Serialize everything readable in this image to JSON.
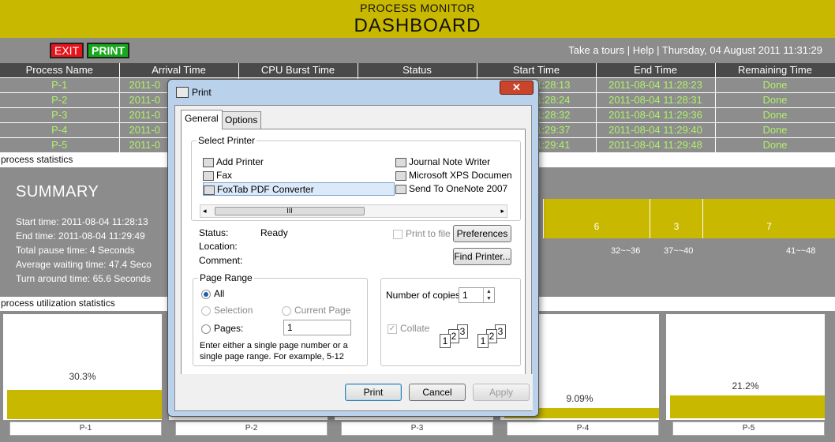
{
  "header": {
    "subtitle": "PROCESS MONITOR",
    "title": "DASHBOARD"
  },
  "toolbar": {
    "exit_label": "EXIT",
    "print_label": "PRINT",
    "tours_link": "Take a tours",
    "sep1": "|",
    "help_link": "Help",
    "sep2": "|",
    "datetime": "Thursday, 04 August 2011 11:31:29"
  },
  "table": {
    "columns": [
      "Process Name",
      "Arrival Time",
      "CPU Burst Time",
      "Status",
      "Start Time",
      "End Time",
      "Remaining Time"
    ],
    "rows": [
      {
        "name": "P-1",
        "arrival": "2011-0",
        "burst": "",
        "status": "",
        "start": "11:28:13",
        "end": "2011-08-04 11:28:23",
        "remaining": "Done"
      },
      {
        "name": "P-2",
        "arrival": "2011-0",
        "burst": "",
        "status": "",
        "start": "11:28:24",
        "end": "2011-08-04 11:28:31",
        "remaining": "Done"
      },
      {
        "name": "P-3",
        "arrival": "2011-0",
        "burst": "",
        "status": "",
        "start": "11:28:32",
        "end": "2011-08-04 11:29:36",
        "remaining": "Done"
      },
      {
        "name": "P-4",
        "arrival": "2011-0",
        "burst": "",
        "status": "",
        "start": "11:29:37",
        "end": "2011-08-04 11:29:40",
        "remaining": "Done"
      },
      {
        "name": "P-5",
        "arrival": "2011-0",
        "burst": "",
        "status": "",
        "start": "11:29:41",
        "end": "2011-08-04 11:29:48",
        "remaining": "Done"
      }
    ]
  },
  "stats_section": {
    "label": "process statistics"
  },
  "summary": {
    "title": "SUMMARY",
    "start_time": "Start time: 2011-08-04 11:28:13",
    "end_time": "End time: 2011-08-04 11:29:49",
    "pause_time": "Total pause time: 4 Seconds",
    "avg_waiting": "Average waiting time: 47.4 Seco",
    "turnaround": "Turn around time: 65.6 Seconds",
    "gantt": [
      {
        "value": "6",
        "range": "32~~36"
      },
      {
        "value": "3",
        "range": "37~~40"
      },
      {
        "value": "7",
        "range": "41~~48"
      }
    ]
  },
  "util_section": {
    "label": "process utilization statistics"
  },
  "utilization": [
    {
      "process": "P-1",
      "percent_text": "30.3%",
      "percent": 30.3
    },
    {
      "process": "P-2",
      "percent_text": "",
      "percent": 0
    },
    {
      "process": "P-3",
      "percent_text": "",
      "percent": 0
    },
    {
      "process": "P-4",
      "percent_text": "9.09%",
      "percent": 9.09
    },
    {
      "process": "P-5",
      "percent_text": "21.2%",
      "percent": 21.2
    }
  ],
  "dialog": {
    "title": "Print",
    "close_label": "✕",
    "tabs": {
      "general": "General",
      "options": "Options"
    },
    "select_printer": {
      "title": "Select Printer",
      "printers": [
        "Add Printer",
        "Fax",
        "FoxTab PDF Converter",
        "Journal Note Writer",
        "Microsoft XPS Documen",
        "Send To OneNote 2007"
      ],
      "selected": "FoxTab PDF Converter",
      "scroll_left": "◂",
      "scroll_right": "▸",
      "scroll_thumb": "III"
    },
    "status_label": "Status:",
    "status_value": "Ready",
    "location_label": "Location:",
    "comment_label": "Comment:",
    "print_to_file": "Print to file",
    "preferences": "Preferences",
    "find_printer": "Find Printer...",
    "page_range": {
      "title": "Page Range",
      "all": "All",
      "selection": "Selection",
      "current_page": "Current Page",
      "pages": "Pages:",
      "pages_value": "1",
      "hint": "Enter either a single page number or a single page range.  For example, 5-12"
    },
    "copies": {
      "label": "Number of copies:",
      "value": "1",
      "collate": "Collate",
      "up": "▲",
      "down": "▼",
      "n1": "1",
      "n2": "2",
      "n3": "3"
    },
    "buttons": {
      "print": "Print",
      "cancel": "Cancel",
      "apply": "Apply"
    }
  },
  "colors": {
    "header_bg": "#c9b800",
    "panel_bg": "#8c8c8c",
    "table_head_bg": "#4a4a4a",
    "table_text": "#aff06a",
    "exit_bg": "#e8141b",
    "print_bg": "#15a81a",
    "dialog_frame": "#b9d1ea"
  }
}
